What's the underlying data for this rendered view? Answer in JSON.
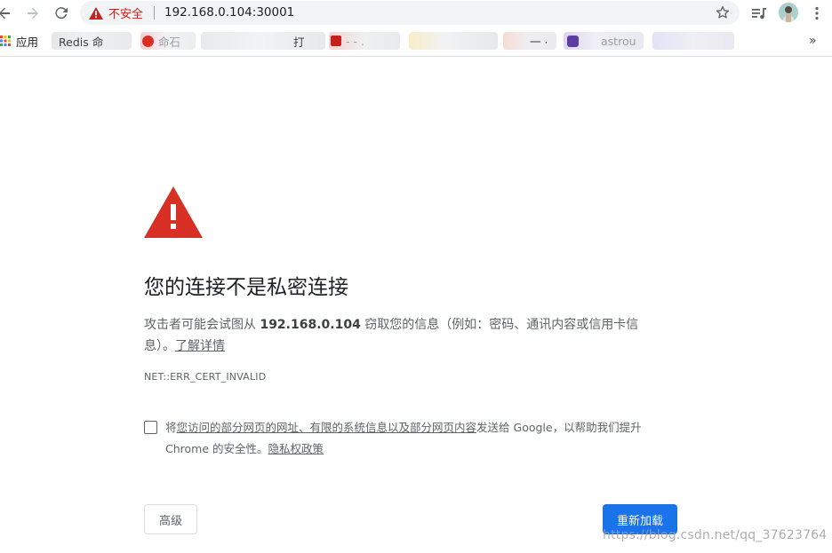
{
  "browser": {
    "security_label": "不安全",
    "url": "192.168.0.104:30001"
  },
  "bookmarks": {
    "apps_label": "应用",
    "items": [
      {
        "label": "Redis 命"
      },
      {
        "label": "命石"
      },
      {
        "label": "打"
      },
      {
        "label": "- - ."
      },
      {
        "label": "一 ·"
      },
      {
        "label": "astrou"
      }
    ],
    "overflow": "»"
  },
  "interstitial": {
    "heading": "您的连接不是私密连接",
    "desc_prefix": "攻击者可能会试图从 ",
    "desc_host": "192.168.0.104",
    "desc_suffix": " 窃取您的信息（例如：密码、通讯内容或信用卡信息）。",
    "learn_more": "了解详情",
    "error_code": "NET::ERR_CERT_INVALID",
    "optin_text_a": "将",
    "optin_link_a": "您访问的部分网页的网址、有限的系统信息以及部分网页内容",
    "optin_text_b": "发送给 Google，以帮助我们提升 Chrome 的安全性。",
    "optin_link_b": "隐私权政策",
    "advanced_button": "高级",
    "reload_button": "重新加载"
  },
  "watermark": "https://blog.csdn.net/qq_37623764",
  "colors": {
    "warning_red": "#d93025",
    "primary_blue": "#1a73e8",
    "insecure_red": "#c5221f"
  }
}
